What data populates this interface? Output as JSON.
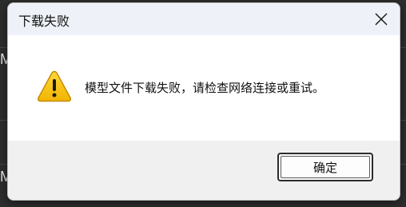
{
  "background": {
    "letters": [
      "M",
      "M"
    ]
  },
  "dialog": {
    "title": "下载失败",
    "message": "模型文件下载失败，请检查网络连接或重试。",
    "ok_label": "确定",
    "icons": {
      "close": "close-icon",
      "warning": "warning-icon"
    },
    "colors": {
      "warning_fill": "#f5c400",
      "warning_border": "#c88a00"
    }
  }
}
